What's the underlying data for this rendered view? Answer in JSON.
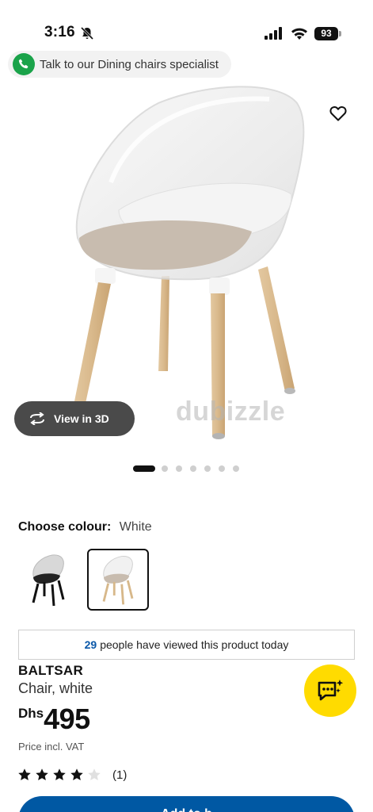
{
  "status_bar": {
    "time": "3:16",
    "battery": "93"
  },
  "specialist_chip": {
    "label": "Talk to our Dining chairs specialist",
    "icon": "phone-icon",
    "icon_color": "#1aa34a"
  },
  "gallery": {
    "view_3d_label": "View in 3D",
    "watermark": "dubizzle",
    "dot_count": 7,
    "active_dot": 1
  },
  "colour": {
    "title": "Choose colour:",
    "selected": "White",
    "swatches": [
      "black",
      "white"
    ]
  },
  "viewed": {
    "count": "29",
    "text": "people have viewed this product today"
  },
  "product": {
    "name": "BALTSAR",
    "description": "Chair, white",
    "currency": "Dhs",
    "price": "495",
    "price_note": "Price incl. VAT",
    "rating_stars": 4,
    "rating_max": 5,
    "rating_count": "(1)"
  },
  "cta": {
    "add_label": "Add to b"
  },
  "colors": {
    "accent_blue": "#0058a3",
    "fab_yellow": "#ffdb00"
  }
}
